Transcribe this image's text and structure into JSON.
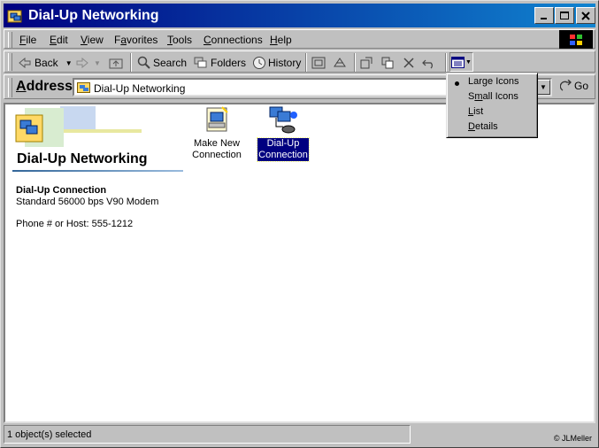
{
  "window": {
    "title": "Dial-Up Networking"
  },
  "menu": [
    {
      "key": "F",
      "rest": "ile"
    },
    {
      "key": "E",
      "rest": "dit"
    },
    {
      "key": "V",
      "rest": "iew"
    },
    {
      "key": "a",
      "pre": "F",
      "rest": "vorites"
    },
    {
      "key": "T",
      "rest": "ools"
    },
    {
      "key": "C",
      "rest": "onnections"
    },
    {
      "key": "H",
      "rest": "elp"
    }
  ],
  "toolbar": {
    "back": "Back",
    "search": "Search",
    "folders": "Folders",
    "history": "History"
  },
  "address": {
    "label_key": "A",
    "label_rest": "ddress",
    "value": "Dial-Up Networking",
    "go": "Go"
  },
  "folder": {
    "title": "Dial-Up Networking",
    "selected_name": "Dial-Up Connection",
    "selected_device": "Standard 56000 bps V90 Modem",
    "selected_phone": "Phone # or Host: 555-1212"
  },
  "icons": {
    "make_new": [
      "Make New",
      "Connection"
    ],
    "dialup": [
      "Dial-Up",
      "Connection"
    ]
  },
  "view_menu": {
    "large": {
      "pre": "Lar",
      "key": "g",
      "rest": "e Icons"
    },
    "small": {
      "pre": "S",
      "key": "m",
      "rest": "all Icons"
    },
    "list": {
      "pre": "",
      "key": "L",
      "rest": "ist"
    },
    "details": {
      "pre": "",
      "key": "D",
      "rest": "etails"
    },
    "checked": "Large Icons"
  },
  "status": {
    "text": "1 object(s) selected",
    "credit": "© JLMeller"
  }
}
